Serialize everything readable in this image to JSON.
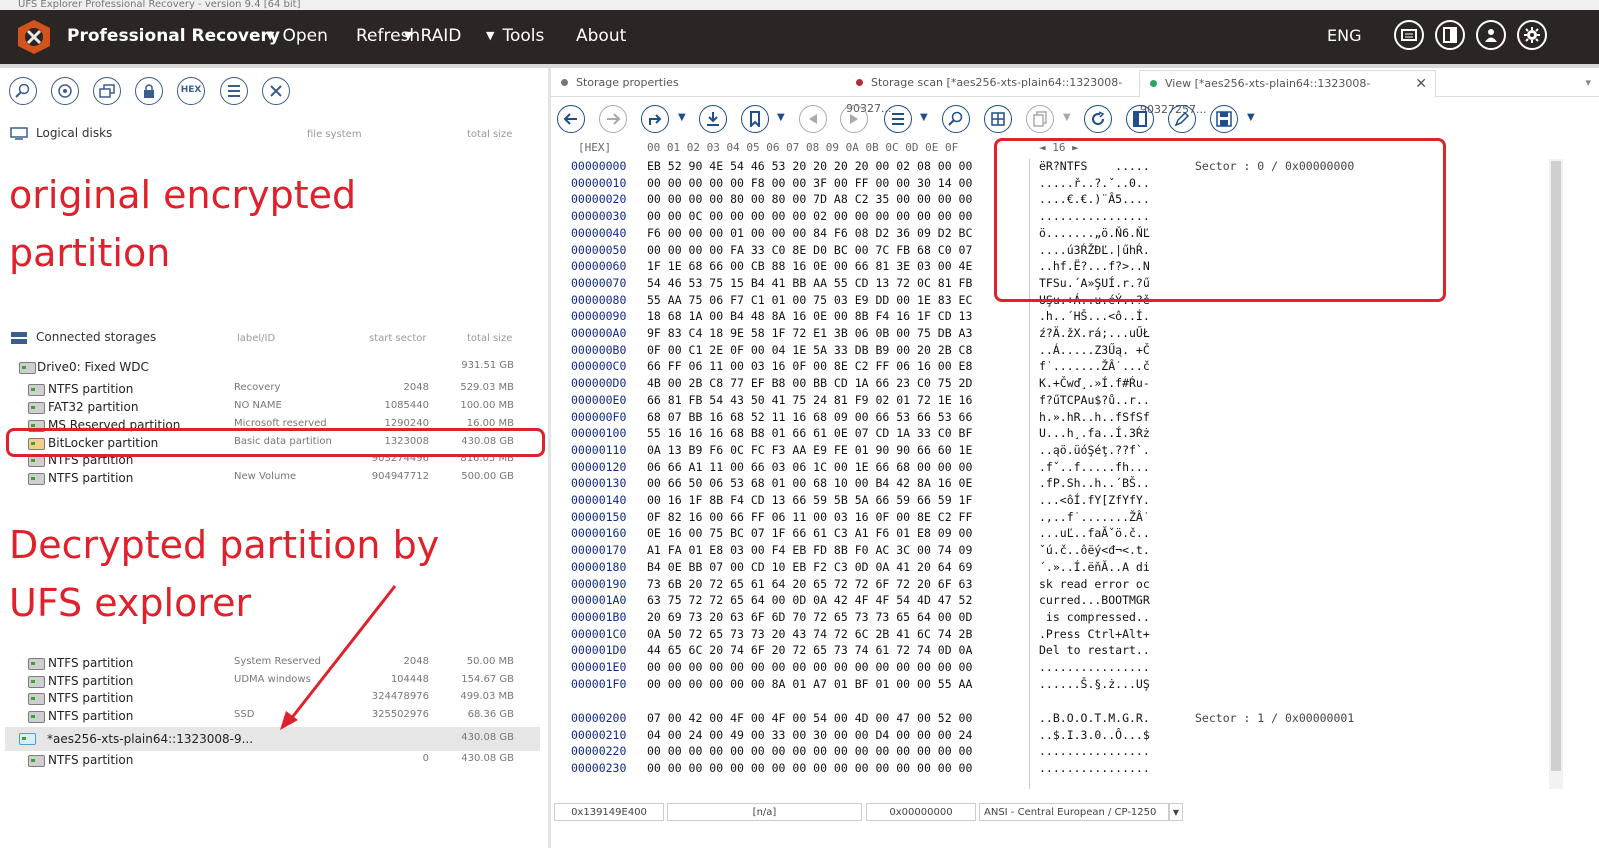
{
  "window": {
    "title": "UFS Explorer Professional Recovery - version 9.4 [64 bit]"
  },
  "topbar": {
    "app_name": "Professional Recovery",
    "menu": [
      {
        "label": "Open",
        "caret": "▼"
      },
      {
        "label": "Refresh"
      },
      {
        "label": "RAID",
        "caret": "▼"
      },
      {
        "label": "Tools",
        "caret": "▼"
      },
      {
        "label": "About"
      }
    ],
    "language": "ENG",
    "icons": [
      "messages-icon",
      "panels-icon",
      "user-icon",
      "settings-icon"
    ]
  },
  "left_panel": {
    "toolbar": [
      "search-icon",
      "disk-scan-icon",
      "copy-files-icon",
      "lock-icon",
      "hex-icon",
      "list-icon",
      "close-icon"
    ],
    "hex_label": "HEX",
    "logical_disks": {
      "title": "Logical disks",
      "col_fs": "file system",
      "col_size": "total size"
    },
    "connected_storages": {
      "title": "Connected storages",
      "col_label": "label/ID",
      "col_start": "start sector",
      "col_size": "total size"
    },
    "rows": [
      {
        "name": "Drive0: Fixed WDC",
        "label": "",
        "start": "",
        "size": "931.51 GB",
        "indent": 0,
        "type": "drive"
      },
      {
        "name": "NTFS partition",
        "label": "Recovery",
        "start": "2048",
        "size": "529.03 MB",
        "indent": 1
      },
      {
        "name": "FAT32 partition",
        "label": "NO NAME",
        "start": "1085440",
        "size": "100.00 MB",
        "indent": 1
      },
      {
        "name": "MS Reserved partition",
        "label": "Microsoft reserved",
        "start": "1290240",
        "size": "16.00 MB",
        "indent": 1
      },
      {
        "name": "BitLocker partition",
        "label": "Basic data partition",
        "start": "1323008",
        "size": "430.08 GB",
        "indent": 1,
        "type": "locked"
      },
      {
        "name": "NTFS partition",
        "label": "",
        "start": "903274496",
        "size": "816.05 MB",
        "indent": 1
      },
      {
        "name": "NTFS partition",
        "label": "New Volume",
        "start": "904947712",
        "size": "500.00 GB",
        "indent": 1
      }
    ],
    "rows2": [
      {
        "name": "NTFS partition",
        "label": "System Reserved",
        "start": "2048",
        "size": "50.00 MB"
      },
      {
        "name": "NTFS partition",
        "label": "UDMA windows",
        "start": "104448",
        "size": "154.67 GB"
      },
      {
        "name": "NTFS partition",
        "label": "",
        "start": "324478976",
        "size": "499.03 MB"
      },
      {
        "name": "NTFS partition",
        "label": "SSD",
        "start": "325502976",
        "size": "68.36 GB"
      },
      {
        "name": "*aes256-xts-plain64::1323008-9...",
        "label": "",
        "start": "",
        "size": "430.08 GB",
        "selected": true
      },
      {
        "name": "NTFS partition",
        "label": "",
        "start": "0",
        "size": "430.08 GB"
      }
    ],
    "annotations": {
      "top_line1": "original encrypted",
      "top_line2": "partition",
      "bottom_line1": "Decrypted partition by",
      "bottom_line2": "UFS explorer"
    }
  },
  "tabs": [
    {
      "label": "Storage properties",
      "color": "#777777"
    },
    {
      "label": "Storage scan [*aes256-xts-plain64::1323008-90327...",
      "color": "#b0303a"
    },
    {
      "label": "View [*aes256-xts-plain64::1323008-90327257...",
      "color": "#2aa55a",
      "active": true
    }
  ],
  "right_toolbar": [
    "back-icon",
    "forward-icon",
    "redo-icon",
    "download-icon",
    "bookmark-icon",
    "prev-mark-icon",
    "next-mark-icon",
    "list-icon",
    "search-icon",
    "grid-icon",
    "copy-icon",
    "refresh-icon",
    "panel-icon",
    "edit-icon",
    "save-icon"
  ],
  "hex_view": {
    "header_label": "[HEX]",
    "header_cols": "00 01 02 03 04 05 06 07 08 09 0A 0B 0C 0D 0E 0F",
    "width_ctrl": "◄ 16 ►",
    "rows": [
      {
        "off": "00000000",
        "hex": "EB 52 90 4E 54 46 53 20 20 20 20 00 02 08 00 00",
        "txt": "ëR?NTFS    .....",
        "sec": "Sector : 0 / 0x00000000"
      },
      {
        "off": "00000010",
        "hex": "00 00 00 00 00 F8 00 00 3F 00 FF 00 00 30 14 00",
        "txt": ".....ř..?.ˇ..0.."
      },
      {
        "off": "00000020",
        "hex": "00 00 00 00 80 00 80 00 7D A8 C2 35 00 00 00 00",
        "txt": "....€.€.)¨Â5...."
      },
      {
        "off": "00000030",
        "hex": "00 00 0C 00 00 00 00 00 02 00 00 00 00 00 00 00",
        "txt": "................"
      },
      {
        "off": "00000040",
        "hex": "F6 00 00 00 01 00 00 00 84 F6 08 D2 36 09 D2 BC",
        "txt": "ö.......„ö.Ň6.ŇĽ"
      },
      {
        "off": "00000050",
        "hex": "00 00 00 00 FA 33 C0 8E D0 BC 00 7C FB 68 C0 07",
        "txt": "....ú3ŔŽĐĽ.|űhŔ."
      },
      {
        "off": "00000060",
        "hex": "1F 1E 68 66 00 CB 88 16 0E 00 66 81 3E 03 00 4E",
        "txt": "..hf.Ë?...f?>..N"
      },
      {
        "off": "00000070",
        "hex": "54 46 53 75 15 B4 41 BB AA 55 CD 13 72 0C 81 FB",
        "txt": "TFSu.´A»ŞUÍ.r.?ű"
      },
      {
        "off": "00000080",
        "hex": "55 AA 75 06 F7 C1 01 00 75 03 E9 DD 00 1E 83 EC",
        "txt": "UŞu.÷Á..u.éÝ..?ě"
      },
      {
        "off": "00000090",
        "hex": "18 68 1A 00 B4 48 8A 16 0E 00 8B F4 16 1F CD 13",
        "txt": ".h..´HŠ...<ô..Í."
      },
      {
        "off": "000000A0",
        "hex": "9F 83 C4 18 9E 58 1F 72 E1 3B 06 0B 00 75 DB A3",
        "txt": "ź?Ä.žX.rá;...uŰŁ"
      },
      {
        "off": "000000B0",
        "hex": "0F 00 C1 2E 0F 00 04 1E 5A 33 DB B9 00 20 2B C8",
        "txt": "..Á.....Z3Űą. +Č"
      },
      {
        "off": "000000C0",
        "hex": "66 FF 06 11 00 03 16 0F 00 8E C2 FF 06 16 00 E8",
        "txt": "f˙.......ŽÂ˙...č"
      },
      {
        "off": "000000D0",
        "hex": "4B 00 2B C8 77 EF B8 00 BB CD 1A 66 23 C0 75 2D",
        "txt": "K.+Čwď¸.»Í.f#Ŕu-"
      },
      {
        "off": "000000E0",
        "hex": "66 81 FB 54 43 50 41 75 24 81 F9 02 01 72 1E 16",
        "txt": "f?űTCPAu$?ů..r.."
      },
      {
        "off": "000000F0",
        "hex": "68 07 BB 16 68 52 11 16 68 09 00 66 53 66 53 66",
        "txt": "h.».hR..h..fSfSf"
      },
      {
        "off": "00000100",
        "hex": "55 16 16 16 68 B8 01 66 61 0E 07 CD 1A 33 C0 BF",
        "txt": "U...h¸.fa..Í.3Ŕż"
      },
      {
        "off": "00000110",
        "hex": "0A 13 B9 F6 0C FC F3 AA E9 FE 01 90 90 66 60 1E",
        "txt": "..ąö.üóŞéţ.??f`."
      },
      {
        "off": "00000120",
        "hex": "06 66 A1 11 00 66 03 06 1C 00 1E 66 68 00 00 00",
        "txt": ".fˇ..f.....fh..."
      },
      {
        "off": "00000130",
        "hex": "00 66 50 06 53 68 01 00 68 10 00 B4 42 8A 16 0E",
        "txt": ".fP.Sh..h..´BŠ.."
      },
      {
        "off": "00000140",
        "hex": "00 16 1F 8B F4 CD 13 66 59 5B 5A 66 59 66 59 1F",
        "txt": "...<ôÍ.fY[ZfYfY."
      },
      {
        "off": "00000150",
        "hex": "0F 82 16 00 66 FF 06 11 00 03 16 0F 00 8E C2 FF",
        "txt": ".,..f˙.......ŽÂ˙"
      },
      {
        "off": "00000160",
        "hex": "0E 16 00 75 BC 07 1F 66 61 C3 A1 F6 01 E8 09 00",
        "txt": "...uĽ..faĂˇö.č.."
      },
      {
        "off": "00000170",
        "hex": "A1 FA 01 E8 03 00 F4 EB FD 8B F0 AC 3C 00 74 09",
        "txt": "ˇú.č..ôëý<đ¬<.t."
      },
      {
        "off": "00000180",
        "hex": "B4 0E BB 07 00 CD 10 EB F2 C3 0D 0A 41 20 64 69",
        "txt": "´.»..Í.ëňĂ..A di"
      },
      {
        "off": "00000190",
        "hex": "73 6B 20 72 65 61 64 20 65 72 72 6F 72 20 6F 63",
        "txt": "sk read error oc"
      },
      {
        "off": "000001A0",
        "hex": "63 75 72 72 65 64 00 0D 0A 42 4F 4F 54 4D 47 52",
        "txt": "curred...BOOTMGR"
      },
      {
        "off": "000001B0",
        "hex": "20 69 73 20 63 6F 6D 70 72 65 73 73 65 64 00 0D",
        "txt": " is compressed.."
      },
      {
        "off": "000001C0",
        "hex": "0A 50 72 65 73 73 20 43 74 72 6C 2B 41 6C 74 2B",
        "txt": ".Press Ctrl+Alt+"
      },
      {
        "off": "000001D0",
        "hex": "44 65 6C 20 74 6F 20 72 65 73 74 61 72 74 0D 0A",
        "txt": "Del to restart.."
      },
      {
        "off": "000001E0",
        "hex": "00 00 00 00 00 00 00 00 00 00 00 00 00 00 00 00",
        "txt": "................"
      },
      {
        "off": "000001F0",
        "hex": "00 00 00 00 00 00 8A 01 A7 01 BF 01 00 00 55 AA",
        "txt": "......Š.§.ż...UŞ"
      },
      {
        "off": "00000200",
        "hex": "07 00 42 00 4F 00 4F 00 54 00 4D 00 47 00 52 00",
        "txt": "..B.O.O.T.M.G.R.",
        "sec": "Sector : 1 / 0x00000001"
      },
      {
        "off": "00000210",
        "hex": "04 00 24 00 49 00 33 00 30 00 00 D4 00 00 00 24",
        "txt": "..$.I.3.0..Ô...$"
      },
      {
        "off": "00000220",
        "hex": "00 00 00 00 00 00 00 00 00 00 00 00 00 00 00 00",
        "txt": "................"
      },
      {
        "off": "00000230",
        "hex": "00 00 00 00 00 00 00 00 00 00 00 00 00 00 00 00",
        "txt": "................"
      }
    ]
  },
  "statusbar": {
    "address": "0x139149E400",
    "na": "[n/a]",
    "offset": "0x00000000",
    "encoding": "ANSI - Central European / CP-1250"
  }
}
